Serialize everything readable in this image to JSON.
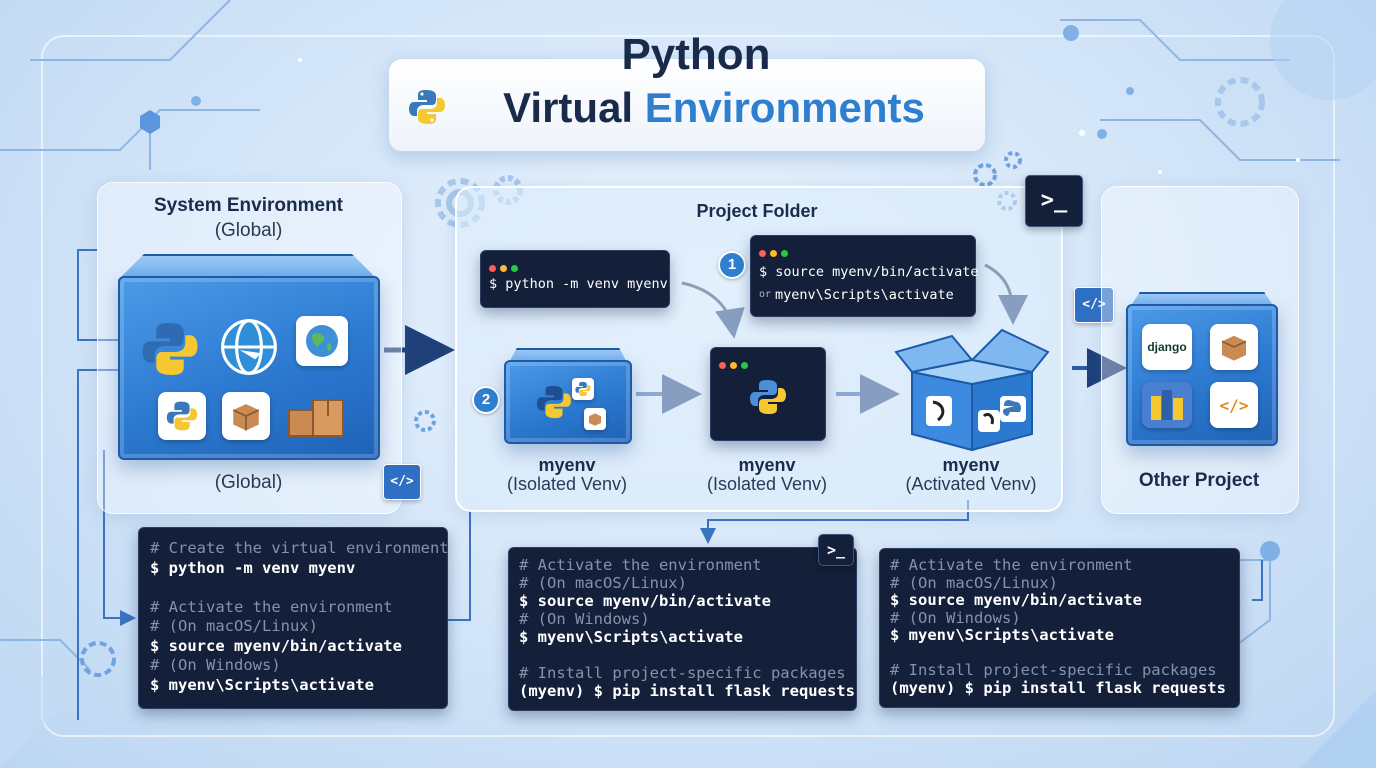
{
  "title": {
    "line1": "Python",
    "line2_word1": "Virtual",
    "line2_word2": "Environments"
  },
  "system": {
    "title": "System Environment",
    "subtitle": "(Global)",
    "footer": "(Global)"
  },
  "project": {
    "title": "Project Folder",
    "create_cmd": "$ python -m venv myenv",
    "activate_cmd_1": "$ source myenv/bin/activate",
    "activate_or": "or",
    "activate_cmd_2": "myenv\\Scripts\\activate",
    "badge_1": "1",
    "badge_2": "2",
    "envs": [
      {
        "name": "myenv",
        "sub": "(Isolated Venv)"
      },
      {
        "name": "myenv",
        "sub": "(Isolated Venv)"
      },
      {
        "name": "myenv",
        "sub": "(Activated Venv)"
      }
    ]
  },
  "other": {
    "title": "Other Project",
    "django_label": "django"
  },
  "icons": {
    "code": "</>",
    "prompt": ">_"
  },
  "code_block_left": {
    "lines": [
      {
        "type": "c",
        "text": "# Create the virtual environment"
      },
      {
        "type": "k",
        "text": "$ python -m venv myenv"
      },
      {
        "type": "b",
        "text": ""
      },
      {
        "type": "c",
        "text": "# Activate the environment"
      },
      {
        "type": "c",
        "text": "# (On macOS/Linux)"
      },
      {
        "type": "k",
        "text": "$ source myenv/bin/activate"
      },
      {
        "type": "c",
        "text": "# (On Windows)"
      },
      {
        "type": "k",
        "text": "$ myenv\\Scripts\\activate"
      }
    ]
  },
  "code_block_mid": {
    "lines": [
      {
        "type": "c",
        "text": "# Activate the environment"
      },
      {
        "type": "c",
        "text": "# (On macOS/Linux)"
      },
      {
        "type": "k",
        "text": "$ source myenv/bin/activate"
      },
      {
        "type": "c",
        "text": "# (On Windows)"
      },
      {
        "type": "k",
        "text": "$ myenv\\Scripts\\activate"
      },
      {
        "type": "b",
        "text": ""
      },
      {
        "type": "c",
        "text": "# Install project-specific packages"
      },
      {
        "type": "k",
        "text": "(myenv) $ pip install flask requests"
      }
    ]
  },
  "code_block_right": {
    "lines": [
      {
        "type": "c",
        "text": "# Activate the environment"
      },
      {
        "type": "c",
        "text": "# (On macOS/Linux)"
      },
      {
        "type": "k",
        "text": "$ source myenv/bin/activate"
      },
      {
        "type": "c",
        "text": "# (On Windows)"
      },
      {
        "type": "k",
        "text": "$ myenv\\Scripts\\activate"
      },
      {
        "type": "b",
        "text": ""
      },
      {
        "type": "c",
        "text": "# Install project-specific packages"
      },
      {
        "type": "k",
        "text": "(myenv) $ pip install flask requests"
      }
    ]
  },
  "colors": {
    "accent": "#2f7fd0",
    "terminal_bg": "#14203a",
    "title_dark": "#1a2a4a"
  }
}
